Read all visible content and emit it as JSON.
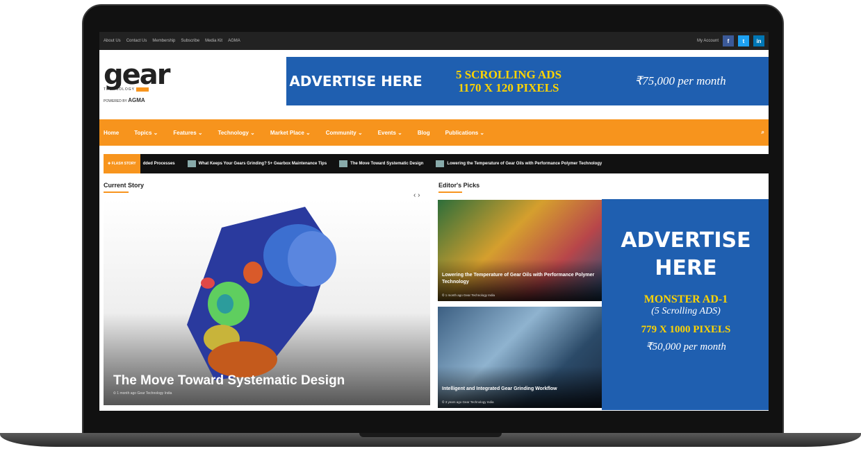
{
  "topbar": {
    "links": [
      "About Us",
      "Contact Us",
      "Membership",
      "Subscribe",
      "Media Kit",
      "AGMA"
    ],
    "account": "My Account",
    "social": [
      "f",
      "t",
      "in"
    ]
  },
  "logo": {
    "word": "gear",
    "tech": "TECHNOLOGY",
    "powered": "POWERED BY",
    "agma": "AGMA"
  },
  "top_ad": {
    "advertise": "ADVERTISE HERE",
    "size_line1": "5 SCROLLING ADS",
    "size_line2": "1170 X 120 PIXELS",
    "price": "₹75,000 per month"
  },
  "nav": {
    "items": [
      "Home",
      "Topics ⌄",
      "Features ⌄",
      "Technology ⌄",
      "Market Place ⌄",
      "Community ⌄",
      "Events ⌄",
      "Blog",
      "Publications ⌄"
    ],
    "search": "⌕"
  },
  "ticker": {
    "flash": "✚ FLASH STORY",
    "first": "dded Processes",
    "items": [
      "What Keeps Your Gears Grinding? 5+ Gearbox Maintenance Tips",
      "The Move Toward Systematic Design",
      "Lowering the Temperature of Gear Oils with Performance Polymer Technology"
    ]
  },
  "current": {
    "label": "Current Story",
    "arrows": "‹  ›",
    "title": "The Move Toward Systematic Design",
    "meta": "⏲ 1 month ago  Gear Technology India"
  },
  "picks": {
    "label": "Editor's Picks",
    "items": [
      {
        "title": "Lowering the Temperature of Gear Oils with Performance Polymer Technology",
        "meta": "⏲ 1 month ago  Gear Technology India"
      },
      {
        "title": "Intelligent and Integrated Gear Grinding Workflow",
        "meta": "⏲ 3 years ago  Gear Technology India"
      }
    ]
  },
  "monster_ad": {
    "advertise_line1": "ADVERTISE",
    "advertise_line2": "HERE",
    "name": "MONSTER AD-1",
    "sub": "(5 Scrolling ADS)",
    "pixels": "779 X 1000 PIXELS",
    "price": "₹50,000 per month"
  }
}
